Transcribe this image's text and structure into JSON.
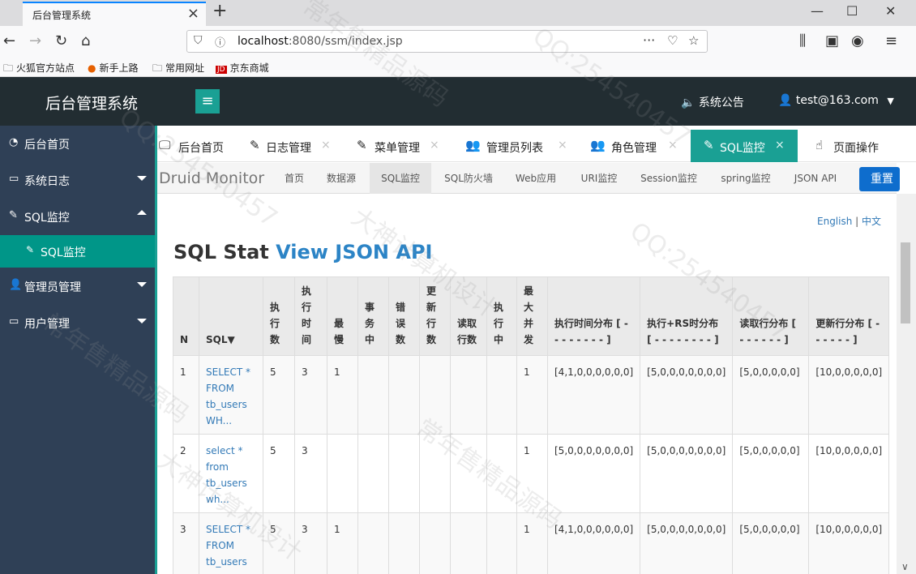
{
  "browser": {
    "tab_title": "后台管理系统",
    "url_prefix": "localhost",
    "url_rest": ":8080/ssm/index.jsp",
    "bookmarks": [
      "火狐官方站点",
      "新手上路",
      "常用网址",
      "京东商城"
    ]
  },
  "header": {
    "brand": "后台管理系统",
    "notice": "系统公告",
    "user": "test@163.com"
  },
  "sidebar": {
    "items": [
      {
        "label": "后台首页",
        "icon": "home-icon"
      },
      {
        "label": "系统日志",
        "icon": "folder-icon"
      },
      {
        "label": "SQL监控",
        "icon": "pencil-icon"
      },
      {
        "label": "管理员管理",
        "icon": "user-icon"
      },
      {
        "label": "用户管理",
        "icon": "folder-icon"
      }
    ],
    "sub_item": "SQL监控"
  },
  "tabs": [
    {
      "label": "后台首页",
      "icon": "monitor-icon"
    },
    {
      "label": "日志管理",
      "icon": "pencil-icon"
    },
    {
      "label": "菜单管理",
      "icon": "pencil-icon"
    },
    {
      "label": "管理员列表",
      "icon": "users-icon"
    },
    {
      "label": "角色管理",
      "icon": "users-icon"
    },
    {
      "label": "SQL监控",
      "icon": "pencil-icon",
      "active": true
    },
    {
      "label": "页面操作",
      "icon": "hand-icon"
    }
  ],
  "druid": {
    "brand": "Druid Monitor",
    "nav": [
      "首页",
      "数据源",
      "SQL监控",
      "SQL防火墙",
      "Web应用",
      "URI监控",
      "Session监控",
      "spring监控",
      "JSON API"
    ],
    "reset": "重置",
    "lang_en": "English",
    "lang_sep": "|",
    "lang_zh": "中文",
    "title": "SQL Stat",
    "title_api": "View JSON API",
    "columns": [
      "N",
      "SQL▼",
      "执行数",
      "执行时间",
      "最慢",
      "事务中",
      "错误数",
      "更新行数",
      "读取行数",
      "执行中",
      "最大并发",
      "执行时间分布 [ - - - - - - - - ]",
      "执行+RS时分布 [ - - - - - - - - ]",
      "读取行分布 [ - - - - - - ]",
      "更新行分布 [ - - - - - - ]"
    ],
    "rows": [
      {
        "n": "1",
        "sql": "SELECT * FROM tb_users WH...",
        "exec": "5",
        "time": "3",
        "slowest": "1",
        "tx": "",
        "err": "",
        "upd": "",
        "read": "",
        "running": "",
        "conc": "1",
        "time_dist": "[4,1,0,0,0,0,0,0]",
        "rs_dist": "[5,0,0,0,0,0,0,0]",
        "read_dist": "[5,0,0,0,0,0]",
        "upd_dist": "[10,0,0,0,0,0]"
      },
      {
        "n": "2",
        "sql": "select * from tb_users wh...",
        "exec": "5",
        "time": "3",
        "slowest": "",
        "tx": "",
        "err": "",
        "upd": "",
        "read": "",
        "running": "",
        "conc": "1",
        "time_dist": "[5,0,0,0,0,0,0,0]",
        "rs_dist": "[5,0,0,0,0,0,0,0]",
        "read_dist": "[5,0,0,0,0,0]",
        "upd_dist": "[10,0,0,0,0,0]"
      },
      {
        "n": "3",
        "sql": "SELECT * FROM tb_users",
        "exec": "5",
        "time": "3",
        "slowest": "1",
        "tx": "",
        "err": "",
        "upd": "",
        "read": "",
        "running": "",
        "conc": "1",
        "time_dist": "[4,1,0,0,0,0,0,0]",
        "rs_dist": "[5,0,0,0,0,0,0,0]",
        "read_dist": "[5,0,0,0,0,0]",
        "upd_dist": "[10,0,0,0,0,0]"
      }
    ]
  },
  "watermark": [
    "常年售精品源码",
    "QQ:254540457",
    "大神计算机设计"
  ]
}
